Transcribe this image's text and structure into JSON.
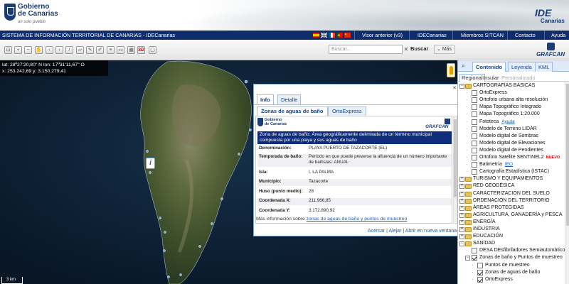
{
  "header": {
    "logo_line1": "Gobierno",
    "logo_line2": "de Canarias",
    "logo_tagline": "un solo pueblo",
    "ide_logo": "IDE",
    "ide_logo_sub": "Canarias"
  },
  "nav": {
    "title": "SISTEMA DE INFORMACIÓN TERRITORIAL DE CANARIAS - IDECanarias",
    "flags": [
      "es-flag",
      "gb-flag",
      "fr-flag",
      "pt-flag",
      "cn-flag"
    ],
    "links": [
      "Visor anterior (v3)",
      "IDECanarias",
      "Miembros SITCAN",
      "Contacto",
      "Ayuda"
    ]
  },
  "toolbar": {
    "tools": [
      "zoom-extent-icon",
      "zoom-in-icon",
      "zoom-out-icon",
      "hand-icon",
      "back-icon",
      "forward-icon",
      "measure-line-icon",
      "measure-area-icon",
      "draw-icon",
      "edit-icon",
      "layers-icon",
      "print-icon",
      "grid-icon",
      "3d-icon",
      "window-icon"
    ],
    "label_3d": "3D",
    "search_placeholder": "Buscar...",
    "search_clear": "✕",
    "search_button": "Buscar",
    "more_button": "Más",
    "brand": "GRAFCAN"
  },
  "map": {
    "coords_line1": "lat: 28º27'20,80\" N lon: 17º31'11,67\" O",
    "coords_line2": "x: 253.242,69 y: 3.150.279,41",
    "scale": "3 km"
  },
  "popup": {
    "tabs": [
      "Info",
      "Detalle"
    ],
    "subtabs": [
      "Zonas de aguas de baño",
      "OrtoExpress"
    ],
    "close": "✕",
    "logo_line1": "Gobierno",
    "logo_line2": "de Canarias",
    "brand": "GRAFCAN",
    "description": "Zona de aguas de baño: Área geográficamente delimitada de un término municipal compuesta por una playa y sus aguas de baño",
    "rows": [
      {
        "label": "Denominación:",
        "value": "PLAYA PUERTO DE TAZACORTE (EL)"
      },
      {
        "label": "Temporada de baño:",
        "value": "Período en que puede preverse la afluencia de un número importante de bañistas: ANUAL"
      },
      {
        "label": "Isla:",
        "value": "I. LA PALMA"
      },
      {
        "label": "Municipio:",
        "value": "Tazacorte"
      },
      {
        "label": "Huso (punto medio):",
        "value": "28"
      },
      {
        "label": "Coordenada X:",
        "value": "211.966,85"
      },
      {
        "label": "Coordenada Y:",
        "value": "3.172.890,92"
      }
    ],
    "more_prefix": "Más información sobre",
    "more_link": "zonas de aguas de baño y puntos de muestreo",
    "actions": [
      "Acercar",
      "Alejar",
      "Abrir en nueva ventana"
    ],
    "action_sep": "|"
  },
  "panel": {
    "tabs": [
      "Contenido",
      "Leyenda",
      "KML"
    ],
    "subtabs": [
      "Regional",
      "Insular",
      "Personalizado"
    ],
    "help_label": "Ayuda",
    "ieo_label": "IEO",
    "nuevo_label": "NUEVO",
    "tree": [
      {
        "label": "CARTOGRAFÍAS BÁSICAS",
        "type": "folder",
        "exp": "−",
        "level": 0
      },
      {
        "label": "OrtoExpress",
        "type": "leaf",
        "level": 1,
        "checked": false
      },
      {
        "label": "Ortofoto urbana alta resolución",
        "type": "leaf",
        "level": 1,
        "checked": false
      },
      {
        "label": "Mapa Topográfico Integrado",
        "type": "leaf",
        "level": 1,
        "checked": false
      },
      {
        "label": "Mapa Topográfico 1:20.000",
        "type": "leaf",
        "level": 1,
        "checked": false
      },
      {
        "label": "Fototeca",
        "type": "leaf",
        "level": 1,
        "checked": false,
        "extra": "help"
      },
      {
        "label": "Modelo de Terreno LIDAR",
        "type": "leaf",
        "level": 1,
        "checked": false
      },
      {
        "label": "Modelo digital de Sombras",
        "type": "leaf",
        "level": 1,
        "checked": false
      },
      {
        "label": "Modelo digital de Elevaciones",
        "type": "leaf",
        "level": 1,
        "checked": false
      },
      {
        "label": "Modelo digital de Pendientes",
        "type": "leaf",
        "level": 1,
        "checked": false
      },
      {
        "label": "Ortofoto Satélite SENTINEL2",
        "type": "leaf",
        "level": 1,
        "checked": false,
        "extra": "nuevo"
      },
      {
        "label": "Batimetría",
        "type": "leaf",
        "level": 1,
        "checked": false,
        "extra": "ieo"
      },
      {
        "label": "Cartografía Estadística (ISTAC)",
        "type": "leaf",
        "level": 1,
        "checked": false
      },
      {
        "label": "TURISMO Y EQUIPAMIENTOS",
        "type": "folder",
        "exp": "+",
        "level": 0
      },
      {
        "label": "RED GEODÉSICA",
        "type": "folder",
        "exp": "+",
        "level": 0
      },
      {
        "label": "CARACTERIZACIÓN DEL SUELO",
        "type": "folder",
        "exp": "+",
        "level": 0
      },
      {
        "label": "ORDENACIÓN DEL TERRITORIO",
        "type": "folder",
        "exp": "+",
        "level": 0
      },
      {
        "label": "ÁREAS PROTEGIDAS",
        "type": "folder",
        "exp": "+",
        "level": 0
      },
      {
        "label": "AGRICULTURA, GANADERÍA y PESCA",
        "type": "folder",
        "exp": "+",
        "level": 0
      },
      {
        "label": "ENERGÍA",
        "type": "folder",
        "exp": "+",
        "level": 0
      },
      {
        "label": "INDUSTRIA",
        "type": "folder",
        "exp": "+",
        "level": 0
      },
      {
        "label": "EDUCACIÓN",
        "type": "folder",
        "exp": "+",
        "level": 0
      },
      {
        "label": "SANIDAD",
        "type": "folder",
        "exp": "−",
        "level": 0
      },
      {
        "label": "DESA DEsfibriladores Semiautomáticos y Au",
        "type": "leaf",
        "level": 1,
        "checked": false
      },
      {
        "label": "Zonas de baño y Puntos de muestreo",
        "type": "leaf",
        "level": 1,
        "checked": true,
        "exp": "−"
      },
      {
        "label": "Puntos de muestreo",
        "type": "leaf",
        "level": 2,
        "checked": false
      },
      {
        "label": "Zonas de aguas de baño",
        "type": "leaf",
        "level": 2,
        "checked": true
      },
      {
        "label": "OrtoExpress",
        "type": "leaf",
        "level": 2,
        "checked": true
      }
    ]
  },
  "colors": {
    "nav_bg": "#0f2d6b",
    "brand_blue": "#1a3d7a",
    "popup_header_bg": "#0f2d7a",
    "link": "#1a5fb4",
    "nuevo": "#dd0000"
  }
}
